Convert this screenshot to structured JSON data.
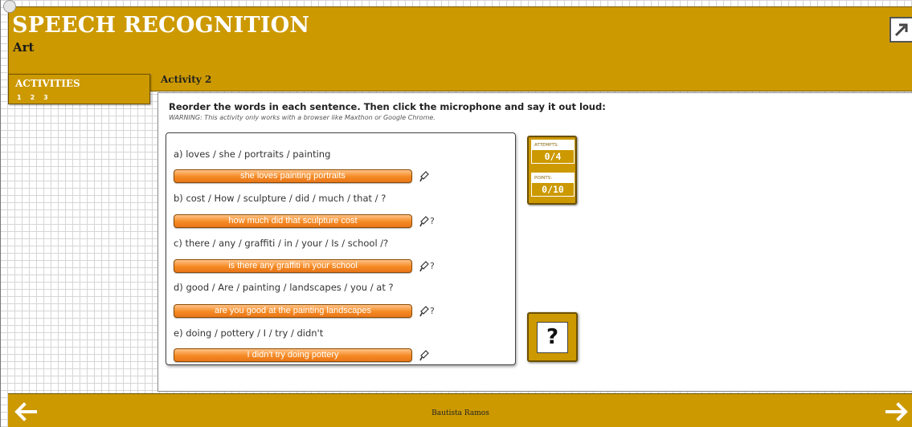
{
  "header": {
    "title": "SPEECH RECOGNITION",
    "subtitle": "Art",
    "expand_icon": "expand-arrow-icon"
  },
  "sidebar": {
    "title": "ACTIVITIES",
    "pages": [
      "1",
      "2",
      "3"
    ]
  },
  "activity": {
    "label": "Activity 2",
    "instructions": "Reorder the words in each sentence. Then click the microphone and say it out loud:",
    "warning": "WARNING: This activity only works with a browser like Maxthon or Google Chrome."
  },
  "questions": [
    {
      "prompt": "a) loves / she / portraits / painting",
      "answer": "she loves painting portraits",
      "status": ""
    },
    {
      "prompt": "b) cost / How / sculpture / did / much / that / ?",
      "answer": "how much did that sculpture cost",
      "status": "?"
    },
    {
      "prompt": "c) there / any / graffiti / in / your / Is / school /?",
      "answer": "is there any graffiti in your school",
      "status": "?"
    },
    {
      "prompt": "d) good / Are / painting / landscapes / you / at ?",
      "answer": "are you good at the painting landscapes",
      "status": "?"
    },
    {
      "prompt": "e) doing / pottery / I / try / didn't",
      "answer": "I didn't try doing pottery",
      "status": ""
    }
  ],
  "score": {
    "attempts_label": "ATTEMPTS:",
    "attempts_value": "0/4",
    "points_label": "POINTS:",
    "points_value": "0/10"
  },
  "help": {
    "label": "?"
  },
  "footer": {
    "author": "Bautista Ramos"
  },
  "colors": {
    "gold": "#cc9900",
    "orange": "#f58a23",
    "white": "#ffffff"
  }
}
